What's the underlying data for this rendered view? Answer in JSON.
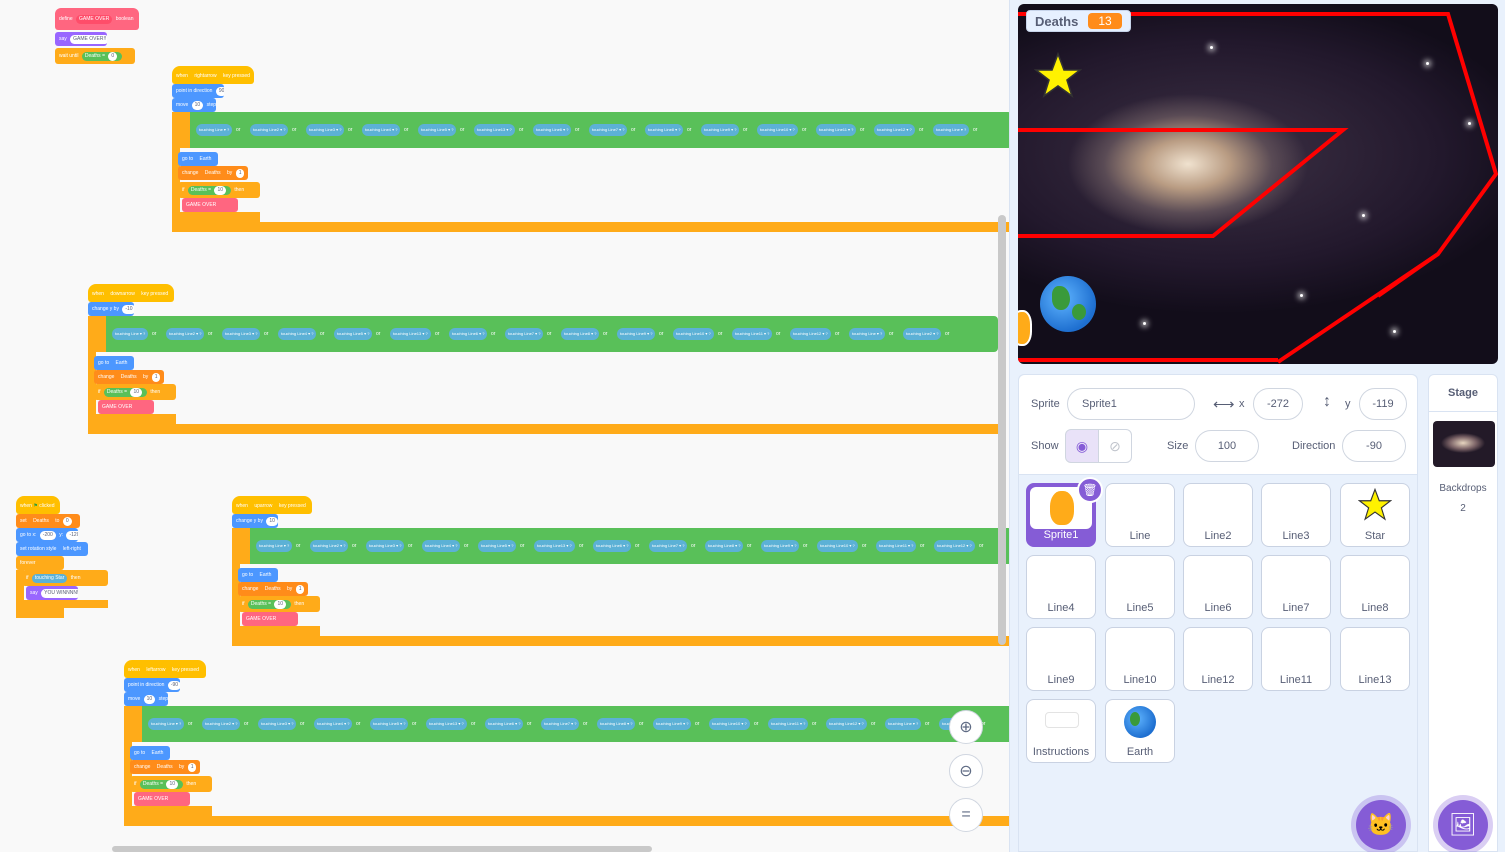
{
  "code_blocks": {
    "define_block": {
      "define": "define",
      "name": "GAME OVER",
      "boolean": "boolean",
      "say": "say",
      "say_text": "GAME OVER!!",
      "wait_until": "wait until",
      "var": "Deaths",
      "eq": "=",
      "zero": "0"
    },
    "right_arrow": {
      "when": "when",
      "key": "rightarrow",
      "pressed": "key pressed",
      "point": "point in direction",
      "dir": "90",
      "move": "move",
      "steps_n": "10",
      "steps": "steps",
      "goto": "go to",
      "earth": "Earth",
      "change": "change",
      "deaths": "Deaths",
      "by": "by",
      "one": "1",
      "if": "if",
      "then": "then",
      "ten": "10",
      "gameover": "GAME OVER"
    },
    "down_arrow": {
      "key": "downarrow",
      "change_y": "change y by",
      "amount": "-10"
    },
    "green_flag": {
      "when_flag": "when",
      "clicked": "clicked",
      "set": "set",
      "to": "to",
      "zero": "0",
      "goto_xy": "go to x:",
      "x_val": "-200",
      "y": "y:",
      "y_val": "-120",
      "rotation": "set rotation style",
      "lr": "left-right",
      "forever": "forever",
      "touching": "touching",
      "star": "Star",
      "say": "say",
      "win_text": "YOU WINNNN!"
    },
    "up_arrow": {
      "key": "uparrow",
      "amount": "10"
    },
    "left_arrow": {
      "key": "leftarrow",
      "dir": "-90"
    },
    "touching_chips": [
      "Line",
      "Line2",
      "Line3",
      "Line4",
      "Line5",
      "Line13",
      "Line6",
      "Line7",
      "Line8",
      "Line9",
      "Line10",
      "Line11",
      "Line12"
    ],
    "touching": "touching",
    "or": "or",
    "q": "?"
  },
  "zoom": {
    "zoom_in": "+",
    "zoom_out": "−",
    "reset": "="
  },
  "stage": {
    "monitor_label": "Deaths",
    "monitor_value": "13"
  },
  "sprite_info": {
    "sprite_label": "Sprite",
    "sprite_name": "Sprite1",
    "x_label": "x",
    "x_value": "-272",
    "y_label": "y",
    "y_value": "-119",
    "show_label": "Show",
    "size_label": "Size",
    "size_value": "100",
    "direction_label": "Direction",
    "direction_value": "-90"
  },
  "sprites": [
    {
      "name": "Sprite1"
    },
    {
      "name": "Line"
    },
    {
      "name": "Line2"
    },
    {
      "name": "Line3"
    },
    {
      "name": "Star"
    },
    {
      "name": "Line4"
    },
    {
      "name": "Line5"
    },
    {
      "name": "Line6"
    },
    {
      "name": "Line7"
    },
    {
      "name": "Line8"
    },
    {
      "name": "Line9"
    },
    {
      "name": "Line10"
    },
    {
      "name": "Line12"
    },
    {
      "name": "Line11"
    },
    {
      "name": "Line13"
    },
    {
      "name": "Instructions"
    },
    {
      "name": "Earth"
    }
  ],
  "stage_panel": {
    "title": "Stage",
    "backdrops_label": "Backdrops",
    "backdrops_count": "2"
  },
  "colors": {
    "accent": "#855cd6",
    "deaths_monitor": "#ff8c1a",
    "stage_lines": "#ff0000"
  }
}
